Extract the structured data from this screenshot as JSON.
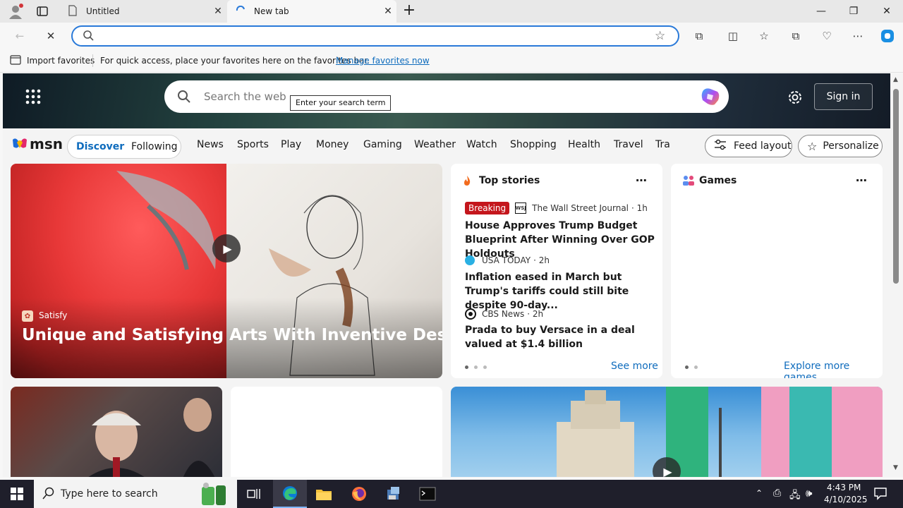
{
  "browser": {
    "tabs": [
      {
        "title": "Untitled"
      },
      {
        "title": "New tab"
      }
    ],
    "favorites_bar": {
      "import_label": "Import favorites",
      "message": "For quick access, place your favorites here on the favorites bar.",
      "manage_link": "Manage favorites now"
    }
  },
  "msn": {
    "search_placeholder": "Search the web",
    "search_tooltip": "Enter your search term",
    "sign_in": "Sign in",
    "logo_text": "msn",
    "feed_tabs": [
      "Discover",
      "Following"
    ],
    "nav_links": [
      "News",
      "Sports",
      "Play",
      "Money",
      "Gaming",
      "Weather",
      "Watch",
      "Shopping",
      "Health",
      "Travel",
      "Tra"
    ],
    "feed_layout": "Feed layout",
    "personalize": "Personalize",
    "hero": {
      "source": "Satisfy",
      "title": "Unique and Satisfying Arts With Inventive Designs"
    },
    "top_stories": {
      "heading": "Top stories",
      "breaking": "Breaking",
      "items": [
        {
          "source": "The Wall Street Journal",
          "age": "· 1h",
          "title": "House Approves Trump Budget Blueprint After Winning Over GOP Holdouts"
        },
        {
          "source": "USA TODAY",
          "age": "· 2h",
          "title": "Inflation eased in March but Trump's tariffs could still bite despite 90-day..."
        },
        {
          "source": "CBS News",
          "age": "· 2h",
          "title": "Prada to buy Versace in a deal valued at $1.4 billion"
        }
      ],
      "see_more": "See more"
    },
    "games": {
      "heading": "Games",
      "explore": "Explore more games"
    }
  },
  "taskbar": {
    "search_placeholder": "Type here to search",
    "time": "4:43 PM",
    "date": "4/10/2025"
  },
  "colors": {
    "accent": "#2a7ad9",
    "link": "#0f6cbd",
    "breaking": "#c4161c"
  }
}
